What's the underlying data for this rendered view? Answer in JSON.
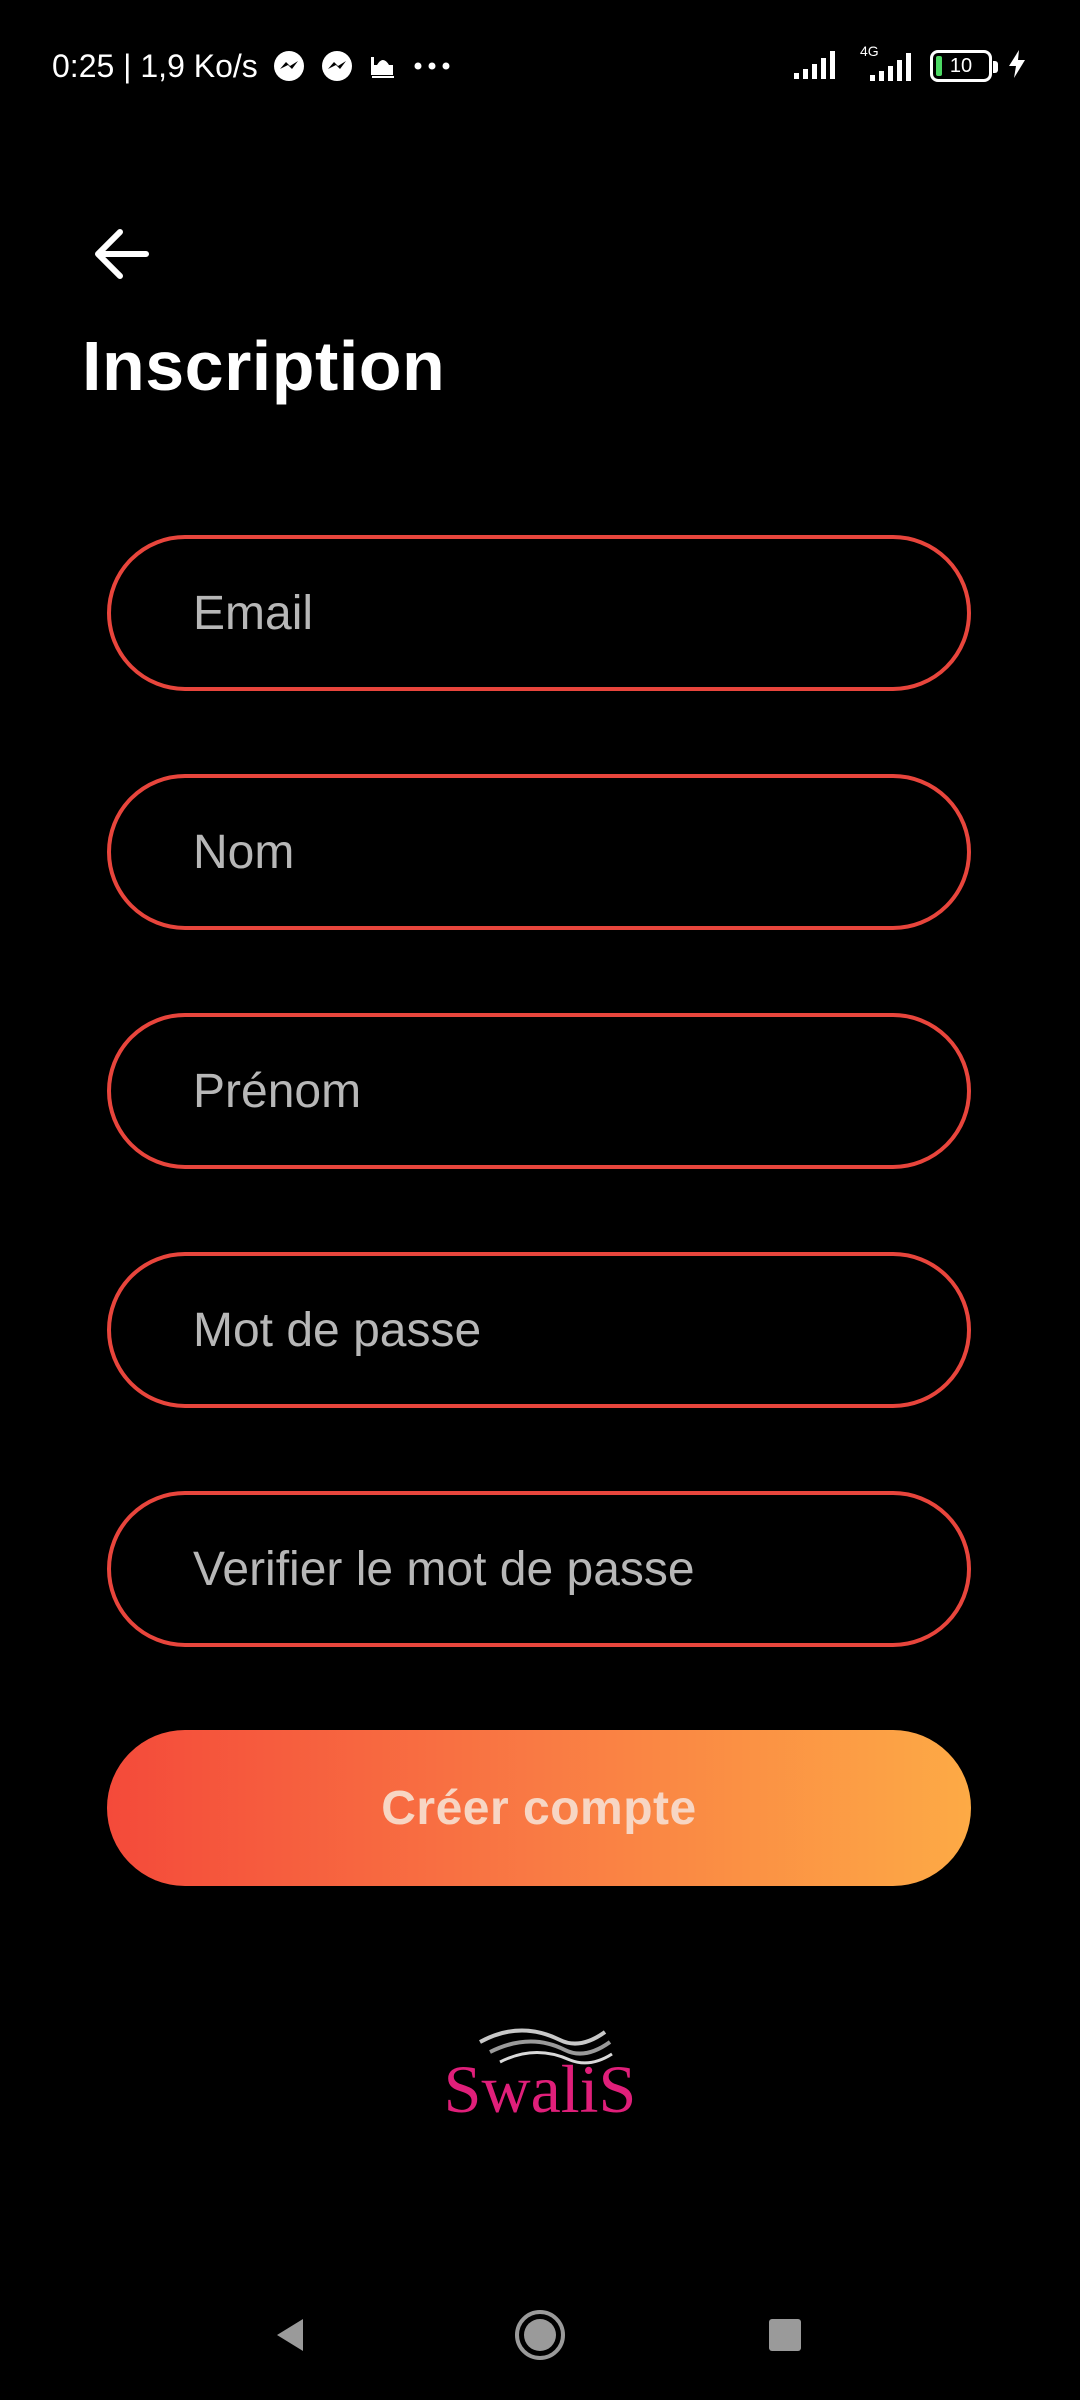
{
  "status_bar": {
    "time_speed": "0:25 | 1,9 Ko/s",
    "network_type": "4G",
    "battery_level": "10",
    "icons": [
      "messenger-icon",
      "messenger-icon",
      "mosque-icon",
      "more-dots-icon",
      "signal-icon",
      "signal-4g-icon",
      "battery-icon",
      "charging-icon"
    ]
  },
  "header": {
    "back_icon": "arrow-left-icon",
    "title": "Inscription"
  },
  "form": {
    "email_placeholder": "Email",
    "nom_placeholder": "Nom",
    "prenom_placeholder": "Prénom",
    "password_placeholder": "Mot de passe",
    "verify_password_placeholder": "Verifier le mot de passe",
    "submit_label": "Créer compte"
  },
  "logo": {
    "text": "SwaliS",
    "color": "#e01f7a"
  },
  "colors": {
    "field_border": "#e8453c",
    "button_gradient_start": "#f44a3a",
    "button_gradient_end": "#fdaa45",
    "background": "#000000"
  },
  "nav_bar": {
    "icons": [
      "back-triangle-icon",
      "home-circle-icon",
      "recents-square-icon"
    ]
  }
}
